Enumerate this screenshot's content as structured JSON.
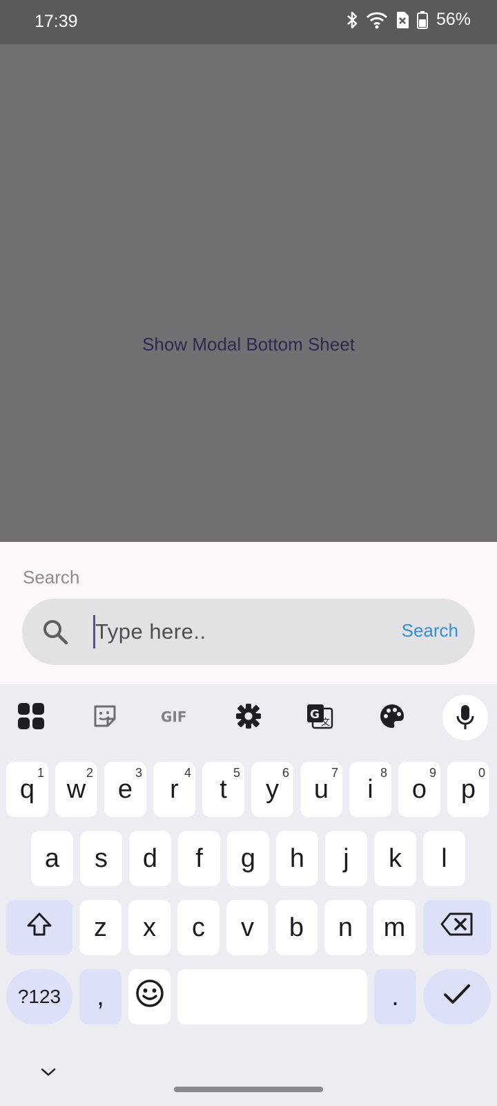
{
  "status_bar": {
    "time": "17:39",
    "battery": "56%",
    "icons": [
      "bluetooth-icon",
      "wifi-icon",
      "sim-off-icon",
      "battery-icon"
    ]
  },
  "main": {
    "show_sheet_label": "Show Modal Bottom Sheet"
  },
  "sheet": {
    "label": "Search",
    "placeholder": "Type here..",
    "search_action": "Search"
  },
  "keyboard": {
    "toolbar": [
      "apps-grid-icon",
      "sticker-icon",
      "gif-icon",
      "settings-icon",
      "translate-icon",
      "palette-icon",
      "mic-icon"
    ],
    "row1": [
      {
        "k": "q",
        "h": "1"
      },
      {
        "k": "w",
        "h": "2"
      },
      {
        "k": "e",
        "h": "3"
      },
      {
        "k": "r",
        "h": "4"
      },
      {
        "k": "t",
        "h": "5"
      },
      {
        "k": "y",
        "h": "6"
      },
      {
        "k": "u",
        "h": "7"
      },
      {
        "k": "i",
        "h": "8"
      },
      {
        "k": "o",
        "h": "9"
      },
      {
        "k": "p",
        "h": "0"
      }
    ],
    "row2": [
      "a",
      "s",
      "d",
      "f",
      "g",
      "h",
      "j",
      "k",
      "l"
    ],
    "row3": [
      "z",
      "x",
      "c",
      "v",
      "b",
      "n",
      "m"
    ],
    "symbols_label": "?123",
    "comma": ",",
    "period": "."
  },
  "colors": {
    "accent": "#3390d6",
    "modifier_key": "#dde1f7",
    "scrim": "#736f72",
    "sheet_bg": "#fdf7fd"
  }
}
